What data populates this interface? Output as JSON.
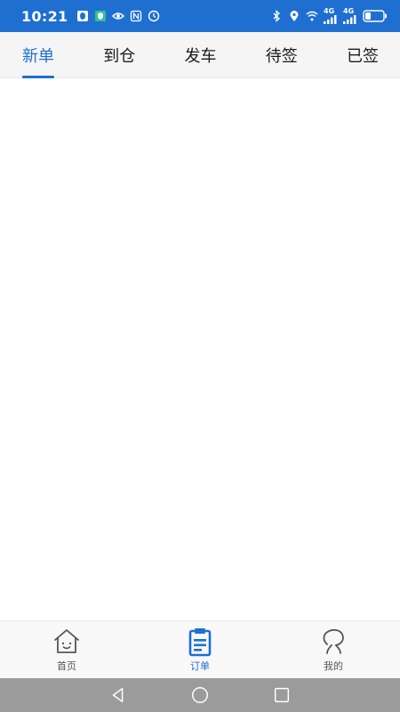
{
  "status_bar": {
    "time": "10:21",
    "network_1": "4G",
    "network_2": "4G",
    "left_icons": [
      "qq-icon",
      "shield-app-icon",
      "eye-icon",
      "nfc-icon",
      "clock-app-icon"
    ],
    "right_icons": [
      "bluetooth-icon",
      "location-icon",
      "wifi-icon",
      "signal-icon",
      "signal-icon",
      "battery-icon"
    ],
    "background": "#1e6fd0"
  },
  "tabs": [
    {
      "label": "新单",
      "active": true
    },
    {
      "label": "到仓",
      "active": false
    },
    {
      "label": "发车",
      "active": false
    },
    {
      "label": "待签",
      "active": false
    },
    {
      "label": "已签",
      "active": false
    }
  ],
  "bottom_nav": [
    {
      "label": "首页",
      "icon": "home-icon",
      "active": false
    },
    {
      "label": "订单",
      "icon": "clipboard-icon",
      "active": true
    },
    {
      "label": "我的",
      "icon": "profile-icon",
      "active": false
    }
  ],
  "system_nav": [
    "back-icon",
    "home-circle-icon",
    "recents-icon"
  ],
  "colors": {
    "accent": "#1e6fd0",
    "tab_bar_bg": "#f5f5f5",
    "bottom_nav_bg": "#f8f8f8",
    "system_nav_bg": "#9b9b9b"
  }
}
